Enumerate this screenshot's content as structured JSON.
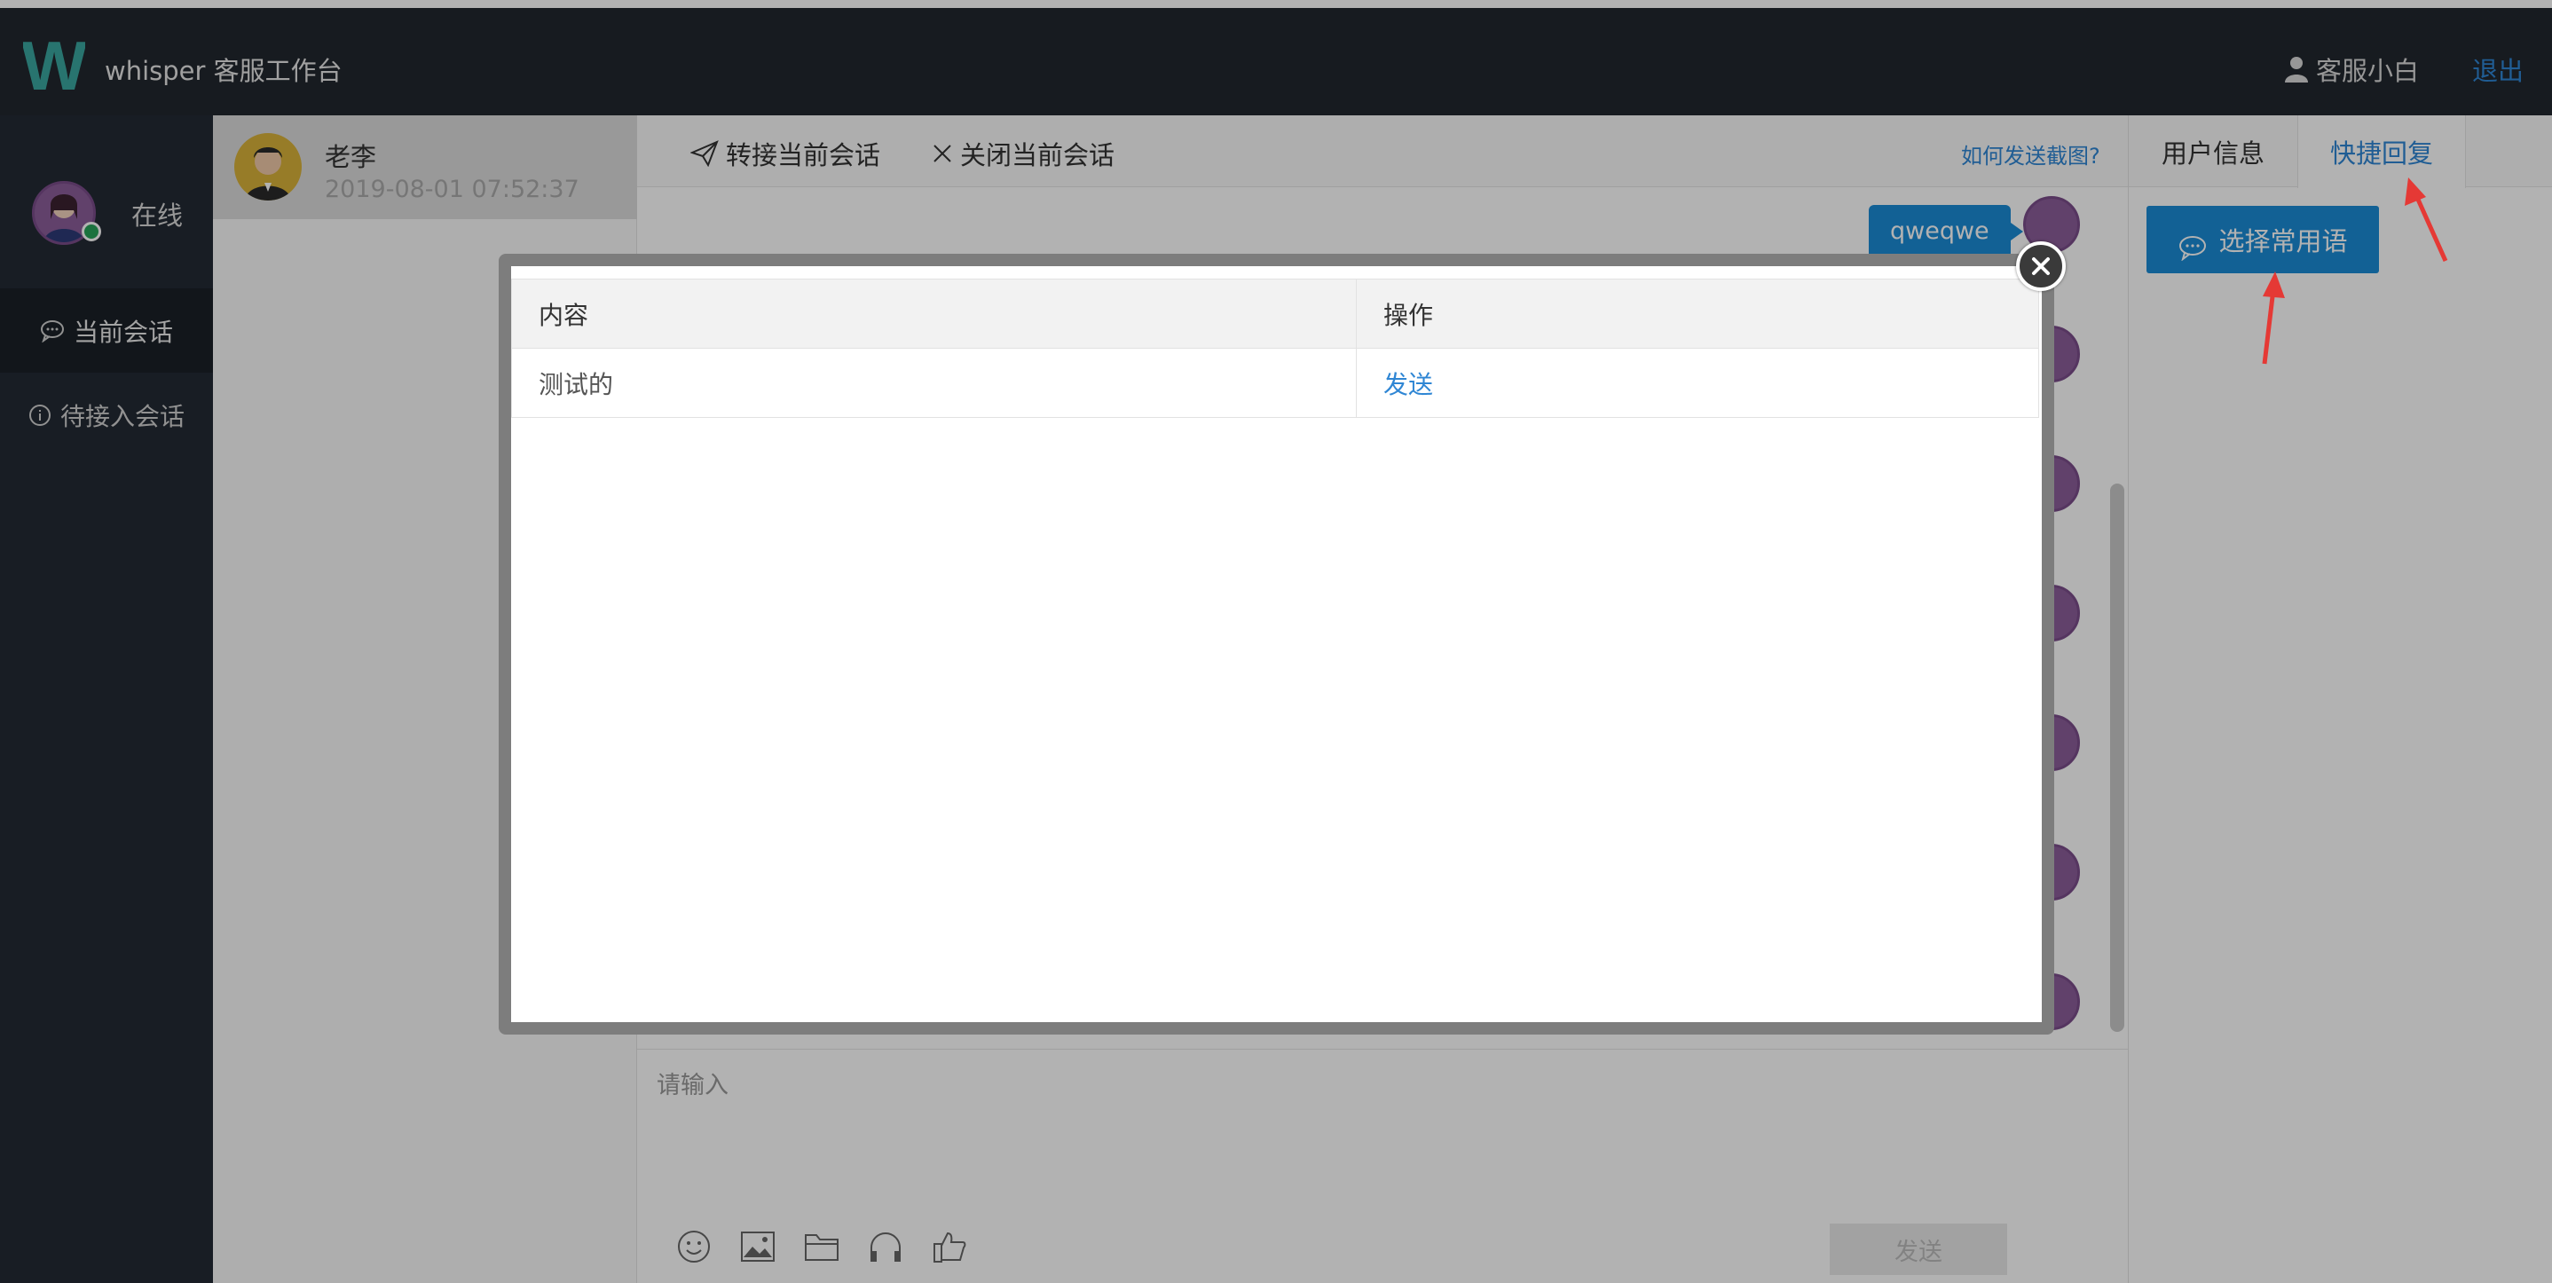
{
  "header": {
    "logo_letter": "W",
    "app_title": "whisper 客服工作台",
    "user_name": "客服小白",
    "logout_label": "退出",
    "user_icon": "user-icon"
  },
  "leftnav": {
    "status": "在线",
    "items": [
      {
        "label": "当前会话",
        "icon": "chat-bubble-icon",
        "active": true
      },
      {
        "label": "待接入会话",
        "icon": "info-circle-icon",
        "active": false
      }
    ]
  },
  "sessions": [
    {
      "name": "老李",
      "time": "2019-08-01 07:52:37"
    }
  ],
  "chat": {
    "toolbar": {
      "transfer_label": "转接当前会话",
      "close_label": "关闭当前会话",
      "help_link": "如何发送截图?"
    },
    "messages": [
      {
        "text": "qweqwe"
      }
    ],
    "input_placeholder": "请输入",
    "send_label": "发送",
    "tools": [
      "emoji-icon",
      "image-icon",
      "folder-icon",
      "headphones-icon",
      "thumbs-up-icon"
    ]
  },
  "right_panel": {
    "tabs": [
      {
        "label": "用户信息",
        "active": false
      },
      {
        "label": "快捷回复",
        "active": true
      }
    ],
    "phrase_button_label": "选择常用语"
  },
  "modal": {
    "columns": [
      "内容",
      "操作"
    ],
    "rows": [
      {
        "content": "测试的",
        "action": "发送"
      }
    ]
  },
  "colors": {
    "topbar": "#22272e",
    "accent": "#1b8bd6",
    "link": "#2f86d4",
    "annotation": "#e53935"
  }
}
